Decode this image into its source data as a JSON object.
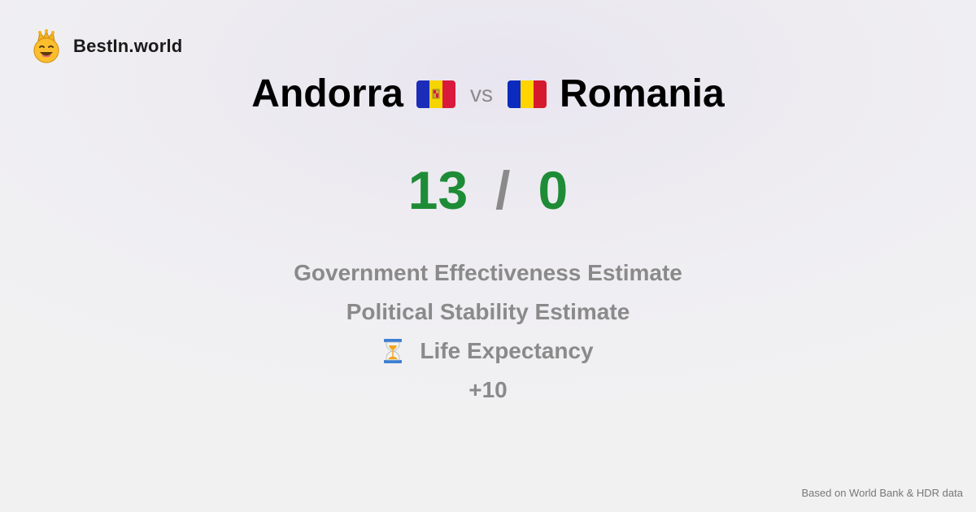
{
  "brand": {
    "name": "BestIn.world",
    "icon": "crown-smiley-icon"
  },
  "comparison": {
    "left": {
      "name": "Andorra",
      "flag_icon": "andorra-flag-icon",
      "flag_colors": [
        "#1a2cb8",
        "#f5d400",
        "#d91a3c"
      ]
    },
    "vs": "vs",
    "right": {
      "name": "Romania",
      "flag_icon": "romania-flag-icon",
      "flag_colors": [
        "#0a2bbd",
        "#ffd500",
        "#d61a2e"
      ]
    }
  },
  "score": {
    "left": "13",
    "separator": "/",
    "right": "0",
    "color": "#1e8c36"
  },
  "metrics": [
    {
      "label": "Government Effectiveness Estimate"
    },
    {
      "label": "Political Stability Estimate"
    },
    {
      "label": "Life Expectancy",
      "icon": "hourglass-icon"
    },
    {
      "label": "+10"
    }
  ],
  "footer": {
    "source": "Based on World Bank & HDR data"
  }
}
